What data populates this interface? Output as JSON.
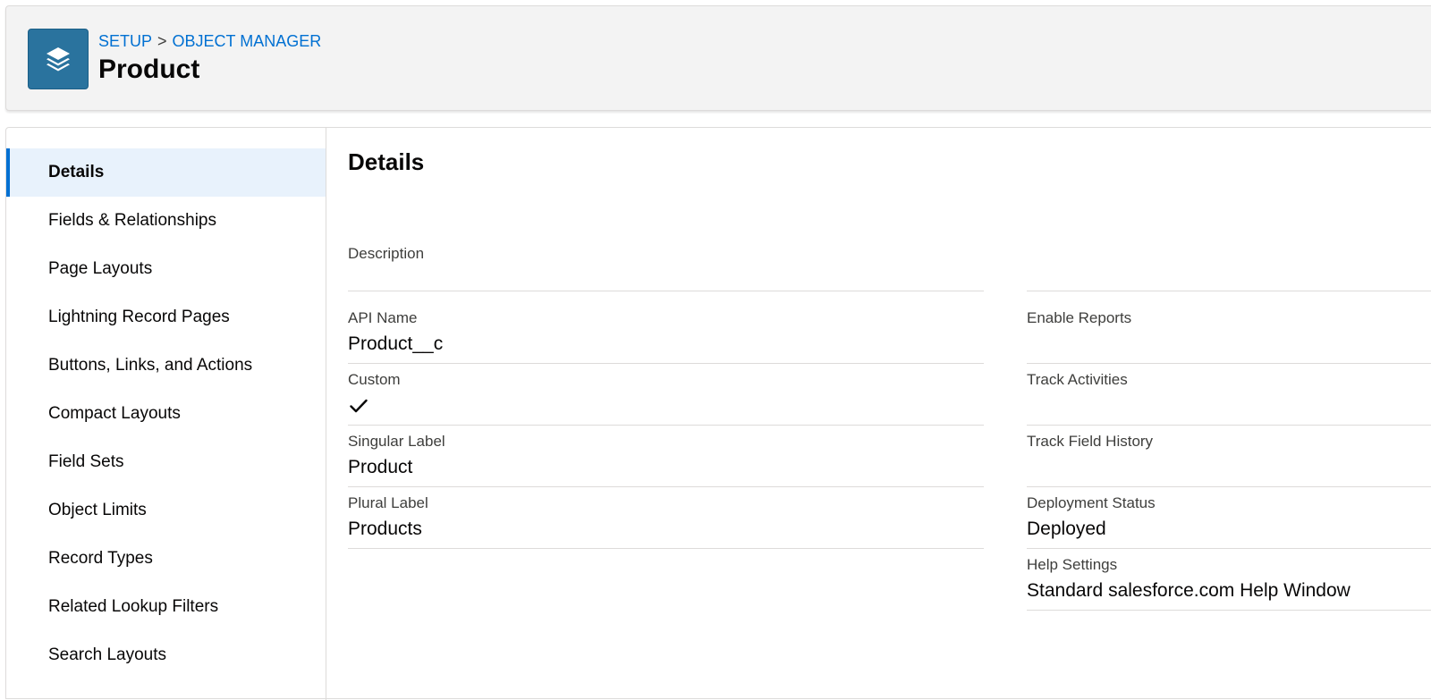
{
  "header": {
    "icon": "stacked-layers-icon",
    "breadcrumb": {
      "setup": "SETUP",
      "separator": ">",
      "object_manager": "OBJECT MANAGER"
    },
    "title": "Product"
  },
  "sidebar": {
    "items": [
      {
        "label": "Details",
        "active": true
      },
      {
        "label": "Fields & Relationships"
      },
      {
        "label": "Page Layouts"
      },
      {
        "label": "Lightning Record Pages"
      },
      {
        "label": "Buttons, Links, and Actions"
      },
      {
        "label": "Compact Layouts"
      },
      {
        "label": "Field Sets"
      },
      {
        "label": "Object Limits"
      },
      {
        "label": "Record Types"
      },
      {
        "label": "Related Lookup Filters"
      },
      {
        "label": "Search Layouts"
      }
    ]
  },
  "details": {
    "title": "Details",
    "left": {
      "description": {
        "label": "Description",
        "value": ""
      },
      "api_name": {
        "label": "API Name",
        "value": "Product__c"
      },
      "custom": {
        "label": "Custom",
        "checked": true,
        "icon": "checkmark-icon"
      },
      "singular_label": {
        "label": "Singular Label",
        "value": "Product"
      },
      "plural_label": {
        "label": "Plural Label",
        "value": "Products"
      }
    },
    "right": {
      "enable_reports": {
        "label": "Enable Reports",
        "value": ""
      },
      "track_activities": {
        "label": "Track Activities",
        "value": ""
      },
      "track_field_history": {
        "label": "Track Field History",
        "value": ""
      },
      "deployment_status": {
        "label": "Deployment Status",
        "value": "Deployed"
      },
      "help_settings": {
        "label": "Help Settings",
        "value": "Standard salesforce.com Help Window"
      }
    }
  },
  "colors": {
    "link": "#0070d2",
    "icon_bg": "#2a739e",
    "active_bg": "#e8f2fc",
    "active_bar": "#0070d2",
    "header_bg": "#f3f3f3",
    "divider": "#dddbda"
  }
}
